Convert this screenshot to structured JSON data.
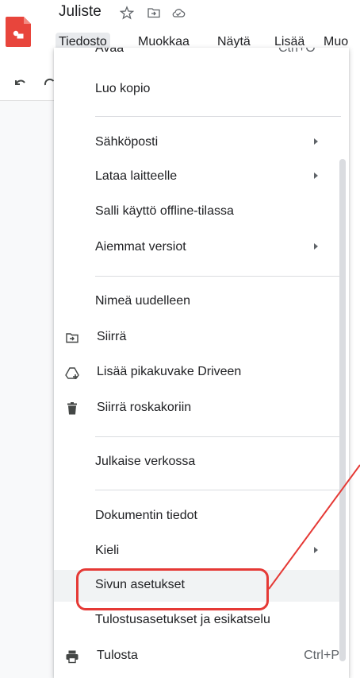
{
  "app": {
    "doc_title": "Juliste",
    "title_icons": [
      "star-icon",
      "move-to-folder-icon",
      "cloud-status-icon"
    ]
  },
  "menubar": {
    "items": [
      "Tiedosto",
      "Muokkaa",
      "Näytä",
      "Lisää",
      "Muo"
    ],
    "active": "Tiedosto"
  },
  "file_menu": {
    "partial_top_label": "Avaa",
    "partial_top_shortcut": "Ctrl+O",
    "items": [
      {
        "label": "Luo kopio"
      },
      {
        "label": "Sähköposti",
        "submenu": true
      },
      {
        "label": "Lataa laitteelle",
        "submenu": true
      },
      {
        "label": "Salli käyttö offline-tilassa"
      },
      {
        "label": "Aiemmat versiot",
        "submenu": true
      },
      {
        "label": "Nimeä uudelleen"
      },
      {
        "label": "Siirrä",
        "icon": "move-to-folder-icon"
      },
      {
        "label": "Lisää pikakuvake Driveen",
        "icon": "add-shortcut-icon"
      },
      {
        "label": "Siirrä roskakoriin",
        "icon": "trash-icon"
      },
      {
        "label": "Julkaise verkossa"
      },
      {
        "label": "Dokumentin tiedot"
      },
      {
        "label": "Kieli",
        "submenu": true
      },
      {
        "label": "Sivun asetukset",
        "highlighted": true
      },
      {
        "label": "Tulostusasetukset ja esikatselu"
      },
      {
        "label": "Tulosta",
        "icon": "print-icon",
        "shortcut": "Ctrl+P"
      }
    ]
  },
  "annotation": {
    "color": "#e53935",
    "target": "Sivun asetukset"
  }
}
